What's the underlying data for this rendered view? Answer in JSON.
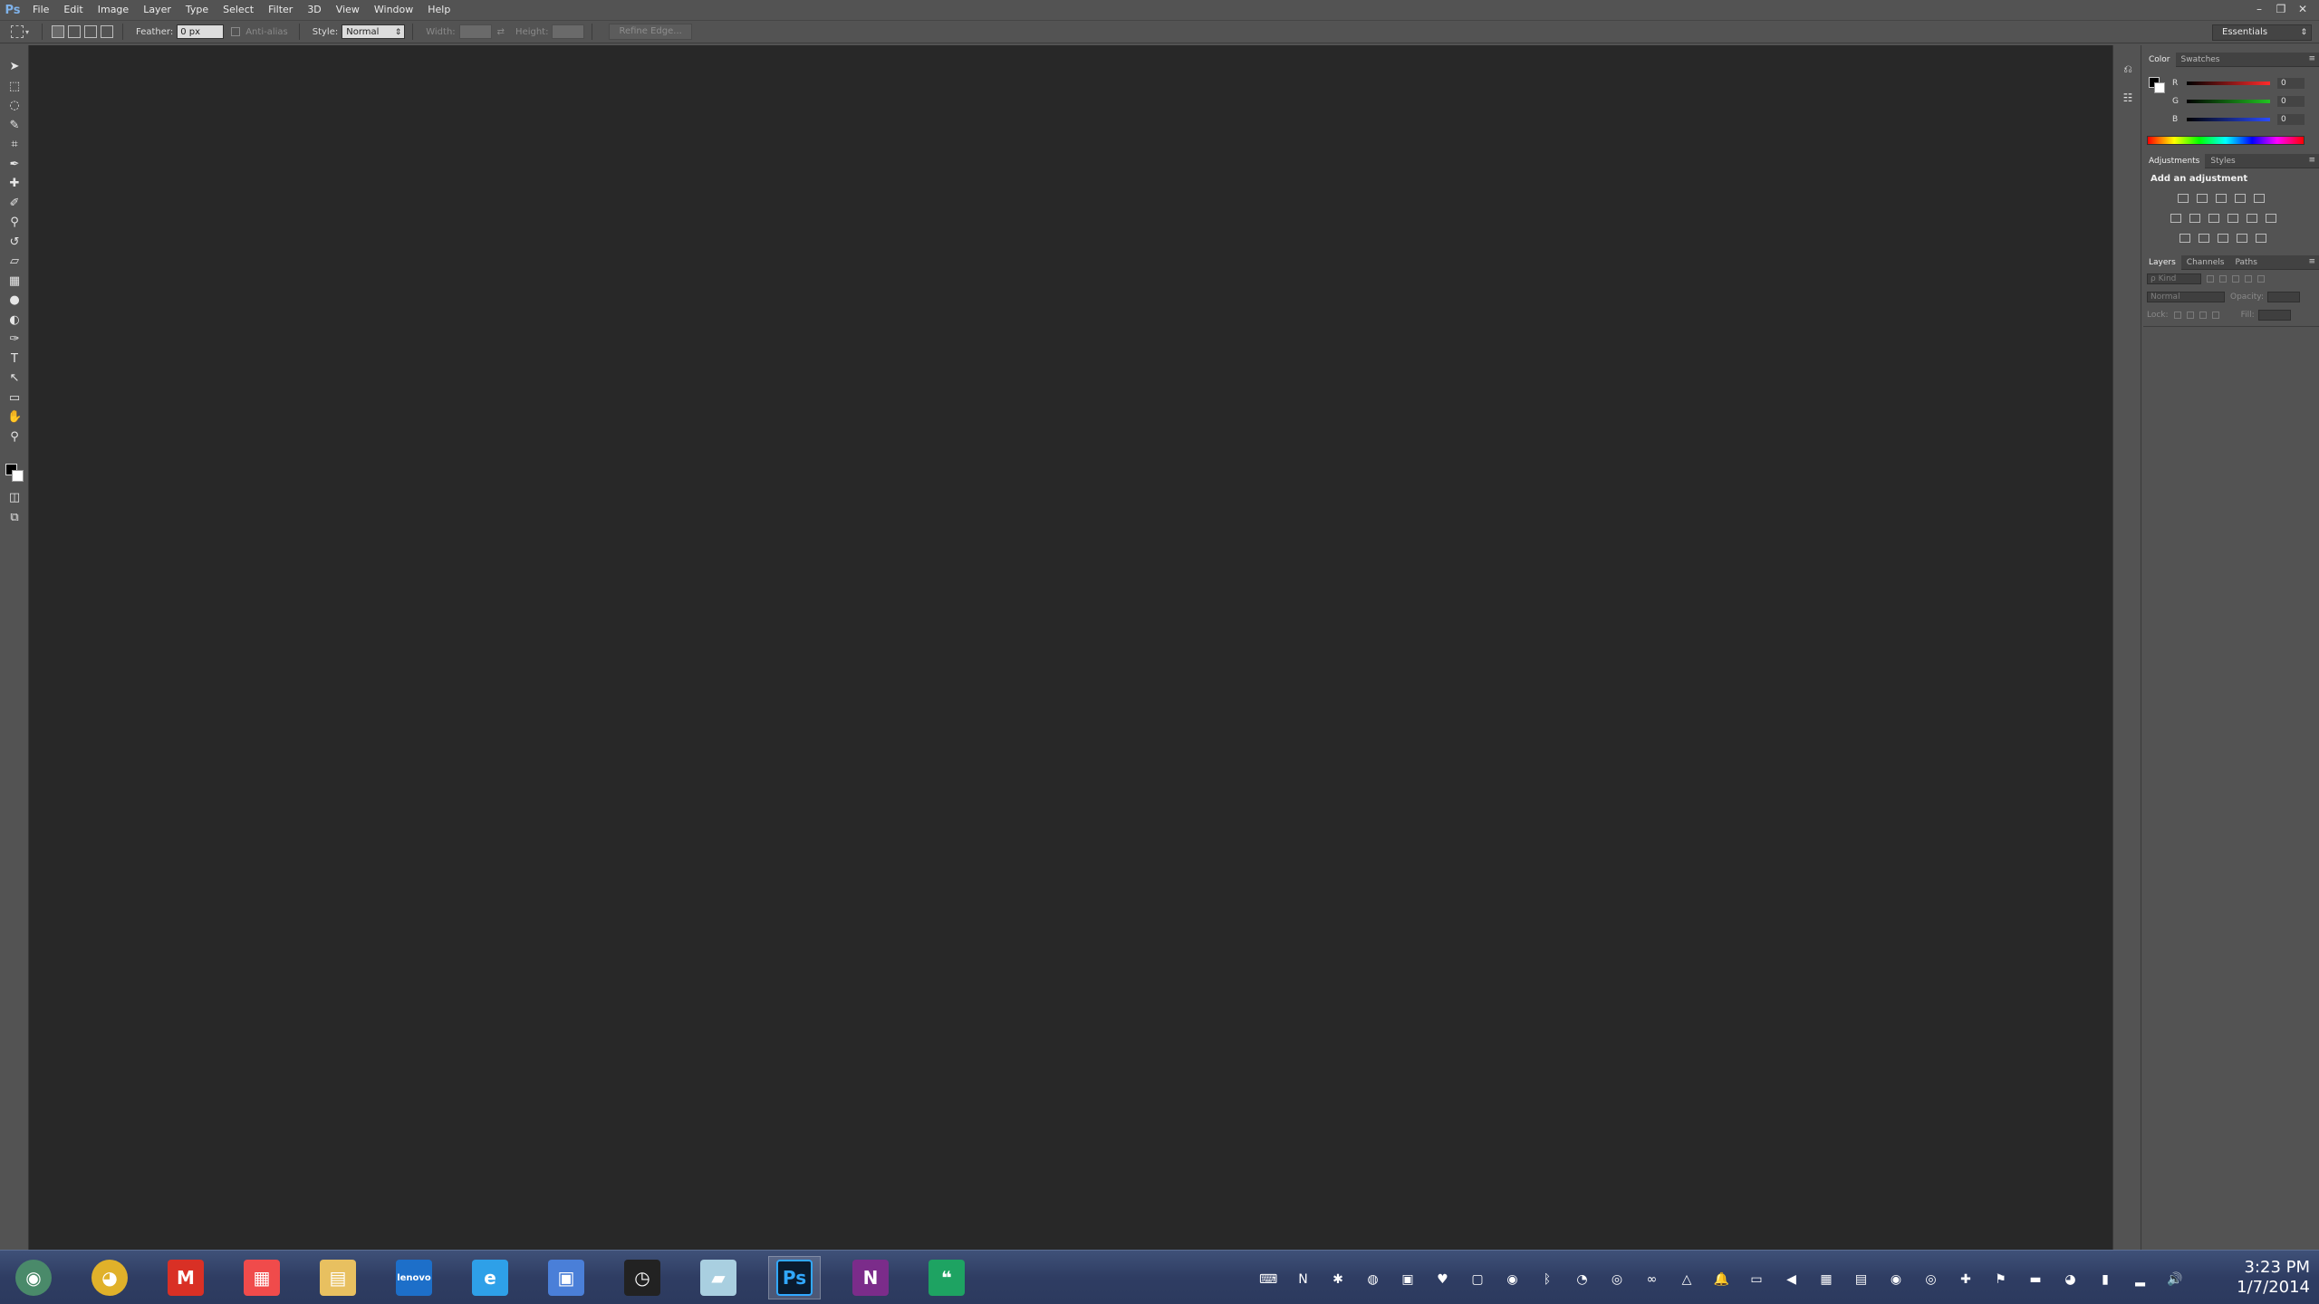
{
  "app": {
    "logo": "Ps",
    "menu": [
      "File",
      "Edit",
      "Image",
      "Layer",
      "Type",
      "Select",
      "Filter",
      "3D",
      "View",
      "Window",
      "Help"
    ],
    "window_controls": [
      "–",
      "❐",
      "✕"
    ]
  },
  "options_bar": {
    "feather_label": "Feather:",
    "feather_value": "0 px",
    "anti_alias_label": "Anti-alias",
    "style_label": "Style:",
    "style_value": "Normal",
    "width_label": "Width:",
    "height_label": "Height:",
    "refine_edge_label": "Refine Edge...",
    "workspace": "Essentials"
  },
  "tools": [
    {
      "name": "move-tool",
      "glyph": "➤"
    },
    {
      "name": "marquee-tool",
      "glyph": "⬚"
    },
    {
      "name": "lasso-tool",
      "glyph": "◌"
    },
    {
      "name": "quick-selection-tool",
      "glyph": "✎"
    },
    {
      "name": "crop-tool",
      "glyph": "⌗"
    },
    {
      "name": "eyedropper-tool",
      "glyph": "✒"
    },
    {
      "name": "healing-brush-tool",
      "glyph": "✚"
    },
    {
      "name": "brush-tool",
      "glyph": "✐"
    },
    {
      "name": "clone-stamp-tool",
      "glyph": "⚲"
    },
    {
      "name": "history-brush-tool",
      "glyph": "↺"
    },
    {
      "name": "eraser-tool",
      "glyph": "▱"
    },
    {
      "name": "gradient-tool",
      "glyph": "▦"
    },
    {
      "name": "blur-tool",
      "glyph": "●"
    },
    {
      "name": "dodge-tool",
      "glyph": "◐"
    },
    {
      "name": "pen-tool",
      "glyph": "✑"
    },
    {
      "name": "type-tool",
      "glyph": "T"
    },
    {
      "name": "path-selection-tool",
      "glyph": "↖"
    },
    {
      "name": "rectangle-tool",
      "glyph": "▭"
    },
    {
      "name": "hand-tool",
      "glyph": "✋"
    },
    {
      "name": "zoom-tool",
      "glyph": "⚲"
    }
  ],
  "panels": {
    "color": {
      "tabs": [
        "Color",
        "Swatches"
      ],
      "channels": [
        {
          "label": "R",
          "value": "0",
          "color": "#ff2b2b"
        },
        {
          "label": "G",
          "value": "0",
          "color": "#22c422"
        },
        {
          "label": "B",
          "value": "0",
          "color": "#2b4dff"
        }
      ]
    },
    "adjustments": {
      "tabs": [
        "Adjustments",
        "Styles"
      ],
      "title": "Add an adjustment"
    },
    "layers": {
      "tabs": [
        "Layers",
        "Channels",
        "Paths"
      ],
      "filter_value": "ρ Kind",
      "blend_mode": "Normal",
      "opacity_label": "Opacity:",
      "lock_label": "Lock:",
      "fill_label": "Fill:"
    }
  },
  "taskbar": {
    "apps": [
      {
        "name": "start-orb",
        "glyph": "◉",
        "color": "#4a8a6a"
      },
      {
        "name": "chrome",
        "glyph": "◕",
        "color": "#e0b12a"
      },
      {
        "name": "gmail",
        "glyph": "M",
        "color": "#d93025"
      },
      {
        "name": "apps-launcher",
        "glyph": "▦",
        "color": "#f04b4b"
      },
      {
        "name": "file-explorer",
        "glyph": "▤",
        "color": "#e8c060"
      },
      {
        "name": "lenovo",
        "glyph": "lenovo",
        "color": "#1d6fc9"
      },
      {
        "name": "internet-explorer",
        "glyph": "e",
        "color": "#2ea0e8"
      },
      {
        "name": "remote-desktop",
        "glyph": "▣",
        "color": "#4a7fd8"
      },
      {
        "name": "stopwatch",
        "glyph": "◷",
        "color": "#222222"
      },
      {
        "name": "scratchpad",
        "glyph": "▰",
        "color": "#a9cfe0"
      },
      {
        "name": "photoshop",
        "glyph": "Ps",
        "color": "#0a1b2e"
      },
      {
        "name": "onenote-screen-clipper",
        "glyph": "N",
        "color": "#7b2c8a"
      },
      {
        "name": "hangouts",
        "glyph": "❝",
        "color": "#1ea362"
      }
    ],
    "clock_time": "3:23 PM",
    "clock_date": "1/7/2014"
  }
}
